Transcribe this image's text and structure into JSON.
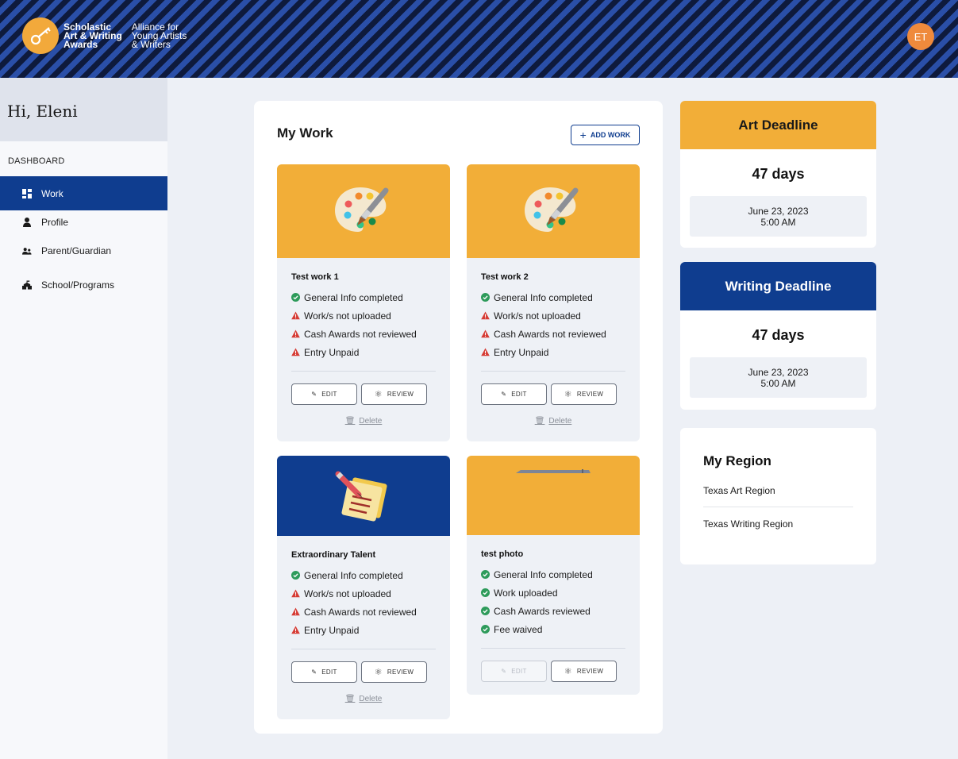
{
  "header": {
    "logo_primary": [
      "Scholastic",
      "Art & Writing",
      "Awards"
    ],
    "logo_secondary": [
      "Alliance for",
      "Young Artists",
      "& Writers"
    ],
    "avatar_initials": "ET",
    "avatar_color": "#ef8a3c"
  },
  "sidebar": {
    "greeting": "Hi, Eleni",
    "section_label": "DASHBOARD",
    "items": [
      {
        "label": "Work",
        "icon": "dashboard-grid-icon",
        "active": true
      },
      {
        "label": "Profile",
        "icon": "person-icon",
        "active": false
      },
      {
        "label": "Parent/Guardian",
        "icon": "family-icon",
        "active": false
      },
      {
        "label": "School/Programs",
        "icon": "school-icon",
        "active": false
      }
    ]
  },
  "work": {
    "title": "My Work",
    "add_button": "ADD WORK",
    "edit_label": "EDIT",
    "review_label": "REVIEW",
    "delete_label": "Delete",
    "cards": [
      {
        "title": "Test work 1",
        "banner": "art-palette-icon",
        "statuses": [
          {
            "text": "General Info completed",
            "ok": true
          },
          {
            "text": "Work/s not uploaded",
            "ok": false
          },
          {
            "text": "Cash Awards not reviewed",
            "ok": false
          },
          {
            "text": "Entry Unpaid",
            "ok": false
          }
        ],
        "edit_enabled": true,
        "deletable": true
      },
      {
        "title": "Test work 2",
        "banner": "art-palette-icon",
        "statuses": [
          {
            "text": "General Info completed",
            "ok": true
          },
          {
            "text": "Work/s not uploaded",
            "ok": false
          },
          {
            "text": "Cash Awards not reviewed",
            "ok": false
          },
          {
            "text": "Entry Unpaid",
            "ok": false
          }
        ],
        "edit_enabled": true,
        "deletable": true
      },
      {
        "title": "Extraordinary Talent",
        "banner": "writing-notes-icon",
        "statuses": [
          {
            "text": "General Info completed",
            "ok": true
          },
          {
            "text": "Work/s not uploaded",
            "ok": false
          },
          {
            "text": "Cash Awards not reviewed",
            "ok": false
          },
          {
            "text": "Entry Unpaid",
            "ok": false
          }
        ],
        "edit_enabled": true,
        "deletable": true
      },
      {
        "title": "test photo",
        "banner": "photo-thumbnail",
        "statuses": [
          {
            "text": "General Info completed",
            "ok": true
          },
          {
            "text": "Work uploaded",
            "ok": true
          },
          {
            "text": "Cash Awards reviewed",
            "ok": true
          },
          {
            "text": "Fee waived",
            "ok": true
          }
        ],
        "edit_enabled": false,
        "deletable": false
      }
    ]
  },
  "deadlines": [
    {
      "title": "Art Deadline",
      "days": "47 days",
      "date": "June 23, 2023",
      "time": "5:00 AM",
      "color": "#f2ae38",
      "text_color": "#1a1a1a"
    },
    {
      "title": "Writing Deadline",
      "days": "47 days",
      "date": "June 23, 2023",
      "time": "5:00 AM",
      "color": "#0f3d8f",
      "text_color": "#ffffff"
    }
  ],
  "region": {
    "title": "My Region",
    "items": [
      "Texas Art Region",
      "Texas Writing Region"
    ]
  },
  "colors": {
    "brand_blue": "#0f3d8f",
    "brand_gold": "#f2ae38",
    "ok_green": "#2e9b5b",
    "warn_red": "#d63b34"
  }
}
